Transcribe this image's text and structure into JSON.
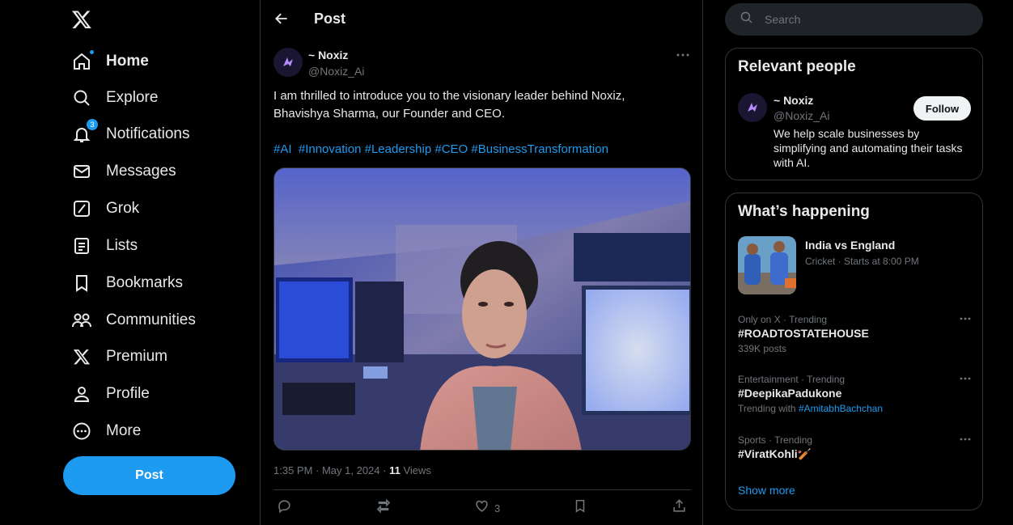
{
  "nav": {
    "items": [
      {
        "label": "Home",
        "icon": "home-icon"
      },
      {
        "label": "Explore",
        "icon": "search-icon"
      },
      {
        "label": "Notifications",
        "icon": "bell-icon",
        "badge": "3"
      },
      {
        "label": "Messages",
        "icon": "mail-icon"
      },
      {
        "label": "Grok",
        "icon": "grok-icon"
      },
      {
        "label": "Lists",
        "icon": "list-icon"
      },
      {
        "label": "Bookmarks",
        "icon": "bookmark-icon"
      },
      {
        "label": "Communities",
        "icon": "communities-icon"
      },
      {
        "label": "Premium",
        "icon": "x-logo-icon"
      },
      {
        "label": "Profile",
        "icon": "person-icon"
      },
      {
        "label": "More",
        "icon": "more-circle-icon"
      }
    ],
    "post_button": "Post"
  },
  "post": {
    "header_title": "Post",
    "author_name": "~ Noxiz",
    "author_handle": "@Noxiz_Ai",
    "text": "I am thrilled to introduce you to the visionary leader behind Noxiz, Bhavishya Sharma, our Founder and CEO.",
    "hashtags": [
      "#AI",
      "#Innovation",
      "#Leadership",
      "#CEO",
      "#BusinessTransformation"
    ],
    "time": "1:35 PM · May 1, 2024 · ",
    "views_count": "11",
    "views_label": " Views",
    "actions": {
      "reply": "",
      "repost": "",
      "like": "3",
      "bookmark": "",
      "share": ""
    }
  },
  "search": {
    "placeholder": "Search"
  },
  "relevant_people": {
    "title": "Relevant people",
    "name": "~ Noxiz",
    "handle": "@Noxiz_Ai",
    "follow_label": "Follow",
    "bio": "We help scale businesses by simplifying and automating their tasks with AI."
  },
  "whats_happening": {
    "title": "What’s happening",
    "featured": {
      "title": "India vs England",
      "meta": "Cricket · Starts at 8:00 PM"
    },
    "trends": [
      {
        "context": "Only on X · Trending",
        "name": "#ROADTOSTATEHOUSE",
        "posts": "339K posts"
      },
      {
        "context": "Entertainment · Trending",
        "name": "#DeepikaPadukone",
        "posts_prefix": "Trending with ",
        "posts_link": "#AmitabhBachchan"
      },
      {
        "context": "Sports · Trending",
        "name": "#ViratKohli🏏"
      }
    ],
    "show_more": "Show more"
  },
  "colors": {
    "accent": "#1d9bf0",
    "background": "#000000",
    "border": "#2f3336",
    "muted": "#71767b"
  }
}
